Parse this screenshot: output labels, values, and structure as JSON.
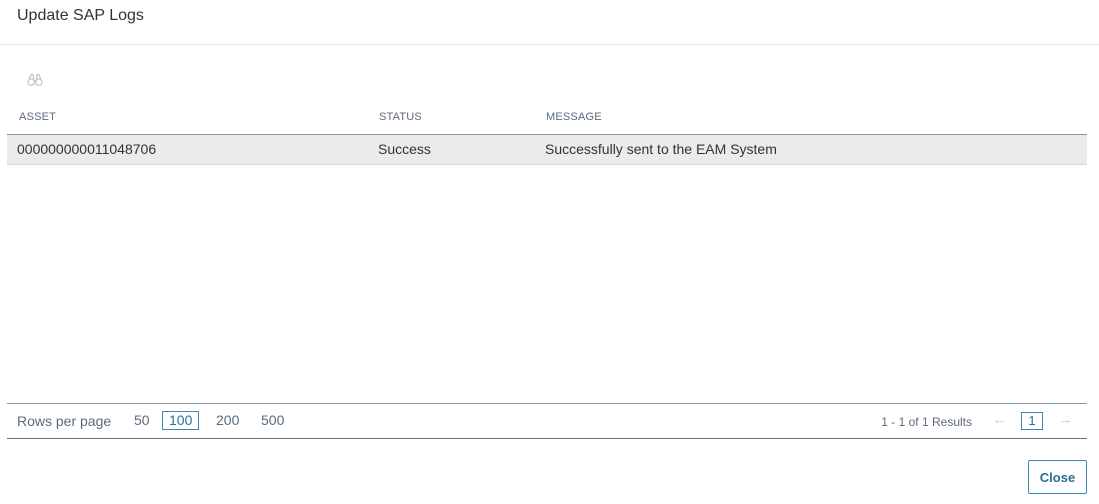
{
  "dialog": {
    "title": "Update SAP Logs"
  },
  "toolbar": {
    "search_icon": "binoculars-icon"
  },
  "grid": {
    "columns": [
      "ASSET",
      "STATUS",
      "MESSAGE"
    ],
    "rows": [
      {
        "asset": "000000000011048706",
        "status": "Success",
        "message": "Successfully sent to the EAM System"
      }
    ]
  },
  "pager": {
    "rows_per_page_label": "Rows per page",
    "page_sizes": [
      "50",
      "100",
      "200",
      "500"
    ],
    "selected_page_size": "100",
    "results_text": "1 - 1 of 1 Results",
    "current_page": "1",
    "prev_icon": "arrow-left-icon",
    "next_icon": "arrow-right-icon"
  },
  "footer": {
    "close_label": "Close"
  },
  "colors": {
    "accent": "#2a6f97",
    "row_background": "#e9ebed",
    "header_text": "#5b6b7b"
  }
}
